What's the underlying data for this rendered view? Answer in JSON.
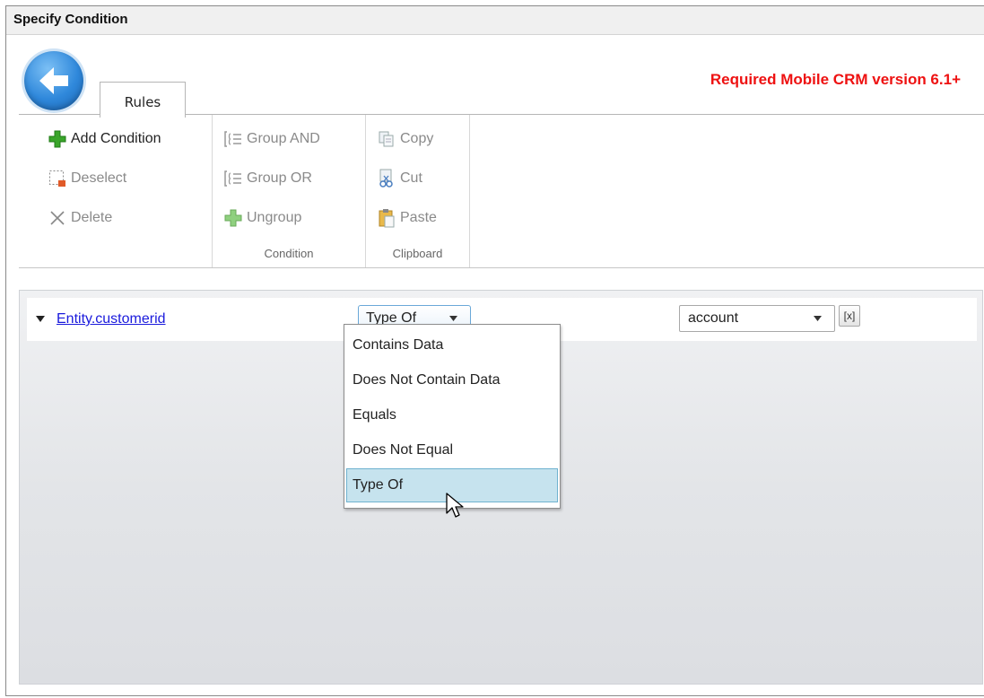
{
  "window": {
    "title": "Specify Condition"
  },
  "header": {
    "back_icon": "back-arrow-icon",
    "tabs": [
      {
        "label": "Rules"
      }
    ],
    "required_note": "Required Mobile CRM version 6.1+",
    "required_note_color": "#ee1111"
  },
  "ribbon": {
    "groups": [
      {
        "label": "",
        "buttons": [
          {
            "label": "Add Condition",
            "icon": "add-plus-icon",
            "enabled": true
          },
          {
            "label": "Deselect",
            "icon": "deselect-icon",
            "enabled": false
          },
          {
            "label": "Delete",
            "icon": "delete-x-icon",
            "enabled": false
          }
        ]
      },
      {
        "label": "Condition",
        "buttons": [
          {
            "label": "Group AND",
            "icon": "group-and-icon",
            "enabled": false
          },
          {
            "label": "Group OR",
            "icon": "group-or-icon",
            "enabled": false
          },
          {
            "label": "Ungroup",
            "icon": "ungroup-plus-icon",
            "enabled": false
          }
        ]
      },
      {
        "label": "Clipboard",
        "buttons": [
          {
            "label": "Copy",
            "icon": "copy-icon",
            "enabled": false
          },
          {
            "label": "Cut",
            "icon": "cut-scissors-icon",
            "enabled": false
          },
          {
            "label": "Paste",
            "icon": "paste-icon",
            "enabled": false
          }
        ]
      }
    ]
  },
  "condition": {
    "field": "Entity.customerid",
    "operator": "Type Of",
    "value": "account",
    "clear_label": "[x]"
  },
  "operator_dropdown": {
    "options": [
      "Contains Data",
      "Does Not Contain Data",
      "Equals",
      "Does Not Equal",
      "Type Of"
    ],
    "selected": "Type Of",
    "highlight_color": "#c6e3ee"
  },
  "colors": {
    "link": "#1a1adc",
    "accent": "#2f88db"
  }
}
